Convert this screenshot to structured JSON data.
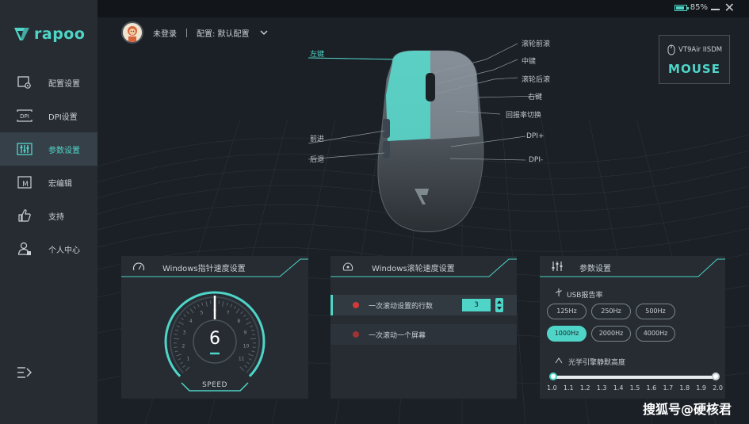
{
  "brand": {
    "name": "rapoo",
    "accent": "#4fd5c8"
  },
  "sidebar": {
    "items": [
      {
        "label": "配置设置",
        "icon": "config-icon"
      },
      {
        "label": "DPI设置",
        "icon": "dpi-icon"
      },
      {
        "label": "参数设置",
        "icon": "params-icon",
        "active": true
      },
      {
        "label": "宏编辑",
        "icon": "macro-icon"
      },
      {
        "label": "支持",
        "icon": "thumbs-up-icon"
      },
      {
        "label": "个人中心",
        "icon": "user-center-icon"
      }
    ],
    "menu_icon": "menu-icon"
  },
  "titlebar": {
    "battery_pct": "85%",
    "battery_level": 0.85
  },
  "user": {
    "name": "未登录",
    "config": "配置: 默认配置"
  },
  "device": {
    "name": "VT9Air IISDM",
    "type": "MOUSE"
  },
  "callouts": {
    "left_button": "左键",
    "scroll_forward": "滚轮前滚",
    "middle": "中键",
    "scroll_back": "滚轮后滚",
    "right_button": "右键",
    "report_rate_switch": "回报率切换",
    "forward": "前进",
    "back": "后退",
    "dpi_plus": "DPI+",
    "dpi_minus": "DPI-"
  },
  "pointer_panel": {
    "title": "Windows指针速度设置",
    "value": "6",
    "speed_label": "SPEED",
    "dial_numbers": [
      "1",
      "2",
      "3",
      "4",
      "5",
      "6",
      "7",
      "8",
      "9",
      "10",
      "11"
    ],
    "level": 6,
    "max": 11
  },
  "wheel_panel": {
    "title": "Windows滚轮速度设置",
    "row1_text": "一次滚动设置的行数",
    "row1_value": "3",
    "row2_text": "一次滚动一个屏幕"
  },
  "params_panel": {
    "title": "参数设置",
    "usb_rate_label": "USB报告率",
    "rates": [
      "125Hz",
      "250Hz",
      "500Hz",
      "1000Hz",
      "2000Hz",
      "4000Hz"
    ],
    "selected_rate": "1000Hz",
    "sensitivity_label": "光学引擎静默高度",
    "ticks": [
      "1.0",
      "1.1",
      "1.2",
      "1.3",
      "1.4",
      "1.5",
      "1.6",
      "1.7",
      "1.8",
      "1.9",
      "2.0"
    ],
    "sensitivity_value": 1.0
  },
  "watermark": "搜狐号@硬核君"
}
